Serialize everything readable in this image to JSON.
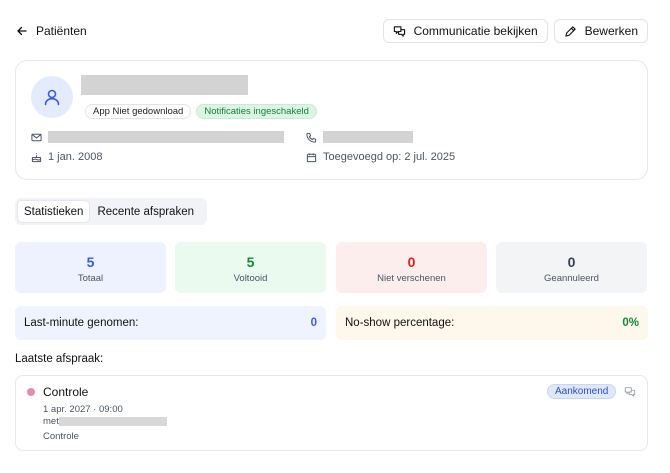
{
  "header": {
    "back_label": "Patiënten",
    "communication_button": "Communicatie bekijken",
    "edit_button": "Bewerken"
  },
  "profile": {
    "badge_app": "App Niet gedownload",
    "badge_notifications": "Notificaties ingeschakeld",
    "birthdate": "1 jan. 2008",
    "added_on": "Toegevoegd op: 2 jul. 2025"
  },
  "tabs": [
    "Statistieken",
    "Recente afspraken"
  ],
  "stats": [
    {
      "value": "5",
      "label": "Totaal"
    },
    {
      "value": "5",
      "label": "Voltooid"
    },
    {
      "value": "0",
      "label": "Niet verschenen"
    },
    {
      "value": "0",
      "label": "Geannuleerd"
    }
  ],
  "metrics": {
    "last_minute_label": "Last-minute genomen:",
    "last_minute_value": "0",
    "noshow_label": "No-show percentage:",
    "noshow_value": "0%"
  },
  "last_appointment": {
    "section_title": "Laatste afspraak:",
    "title": "Controle",
    "datetime": "1 apr. 2027 · 09:00",
    "with_prefix": "met",
    "type": "Controle",
    "status": "Aankomend"
  },
  "colors": {
    "accent_blue": "#3b5ed6",
    "success_green": "#148a3a",
    "danger_red": "#d61f1f",
    "appointment_dot": "#e38bb3"
  }
}
